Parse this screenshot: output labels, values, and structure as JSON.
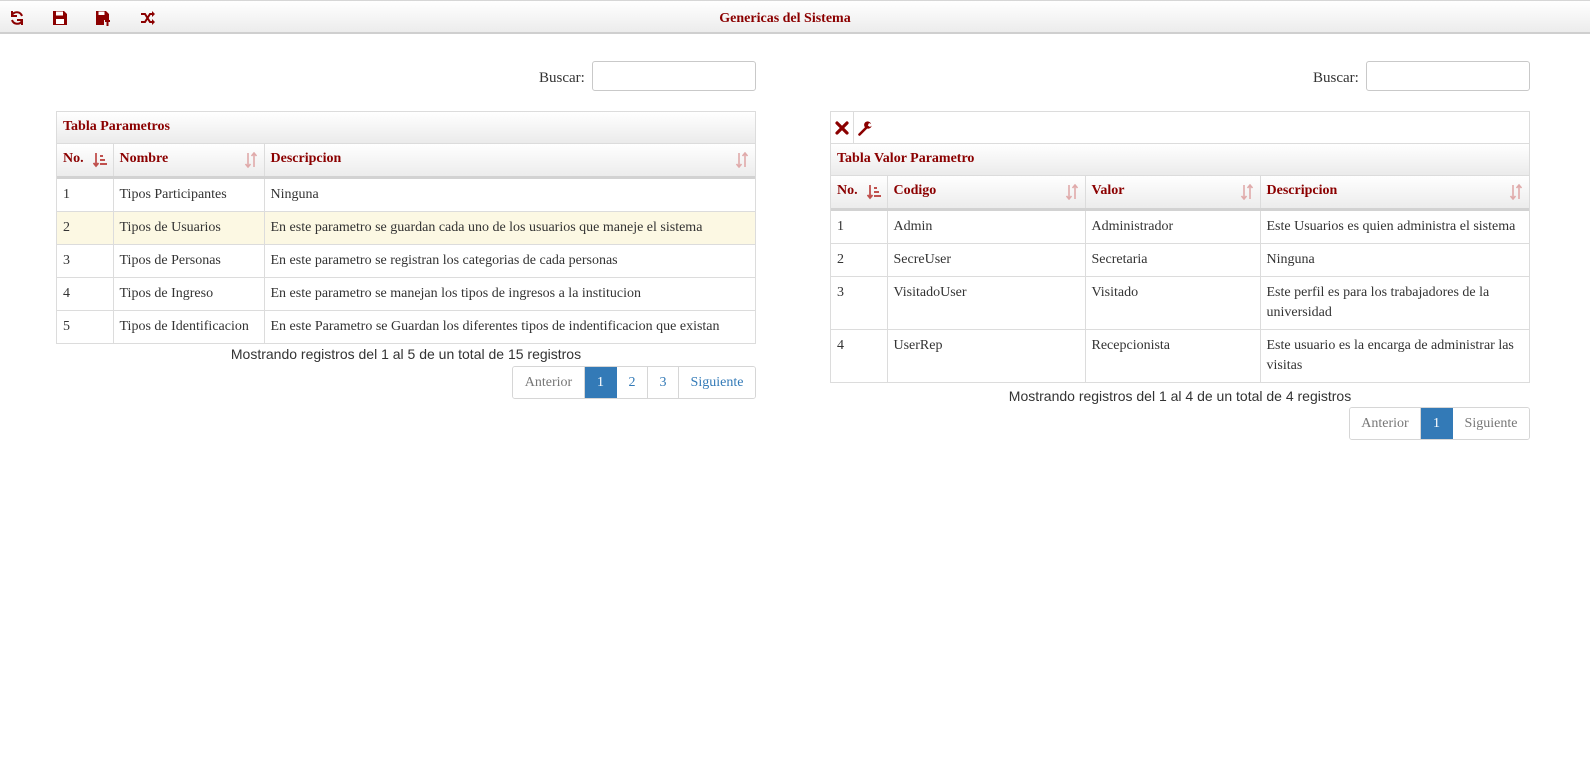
{
  "header": {
    "title": "Genericas del Sistema",
    "icons": [
      "refresh-icon",
      "save-icon",
      "save-as-icon",
      "shuffle-icon"
    ],
    "accent_color": "#8b0000"
  },
  "left": {
    "search_label": "Buscar:",
    "search_value": "",
    "caption": "Tabla Parametros",
    "columns": [
      "No.",
      "Nombre",
      "Descripcion"
    ],
    "rows": [
      [
        "1",
        "Tipos Participantes",
        "Ninguna"
      ],
      [
        "2",
        "Tipos de Usuarios",
        "En este parametro se guardan cada uno de los usuarios que maneje el sistema"
      ],
      [
        "3",
        "Tipos de Personas",
        "En este parametro se registran los categorias de cada personas"
      ],
      [
        "4",
        "Tipos de Ingreso",
        "En este parametro se manejan los tipos de ingresos a la institucion"
      ],
      [
        "5",
        "Tipos de Identificacion",
        "En este Parametro se Guardan los diferentes tipos de indentificacion que existan"
      ]
    ],
    "info": "Mostrando registros del 1 al 5 de un total de 15 registros",
    "pager": {
      "prev": "Anterior",
      "pages": [
        "1",
        "2",
        "3"
      ],
      "next": "Siguiente",
      "active": "1"
    }
  },
  "right": {
    "search_label": "Buscar:",
    "search_value": "",
    "caption": "Tabla Valor Parametro",
    "toolbar_icons": [
      "delete-icon",
      "wrench-icon"
    ],
    "columns": [
      "No.",
      "Codigo",
      "Valor",
      "Descripcion"
    ],
    "rows": [
      [
        "1",
        "Admin",
        "Administrador",
        "Este Usuarios es quien administra el sistema"
      ],
      [
        "2",
        "SecreUser",
        "Secretaria",
        "Ninguna"
      ],
      [
        "3",
        "VisitadoUser",
        "Visitado",
        "Este perfil es para los trabajadores de la universidad"
      ],
      [
        "4",
        "UserRep",
        "Recepcionista",
        "Este usuario es la encarga de administrar las visitas"
      ]
    ],
    "info": "Mostrando registros del 1 al 4 de un total de 4 registros",
    "pager": {
      "prev": "Anterior",
      "pages": [
        "1"
      ],
      "next": "Siguiente",
      "active": "1"
    }
  }
}
